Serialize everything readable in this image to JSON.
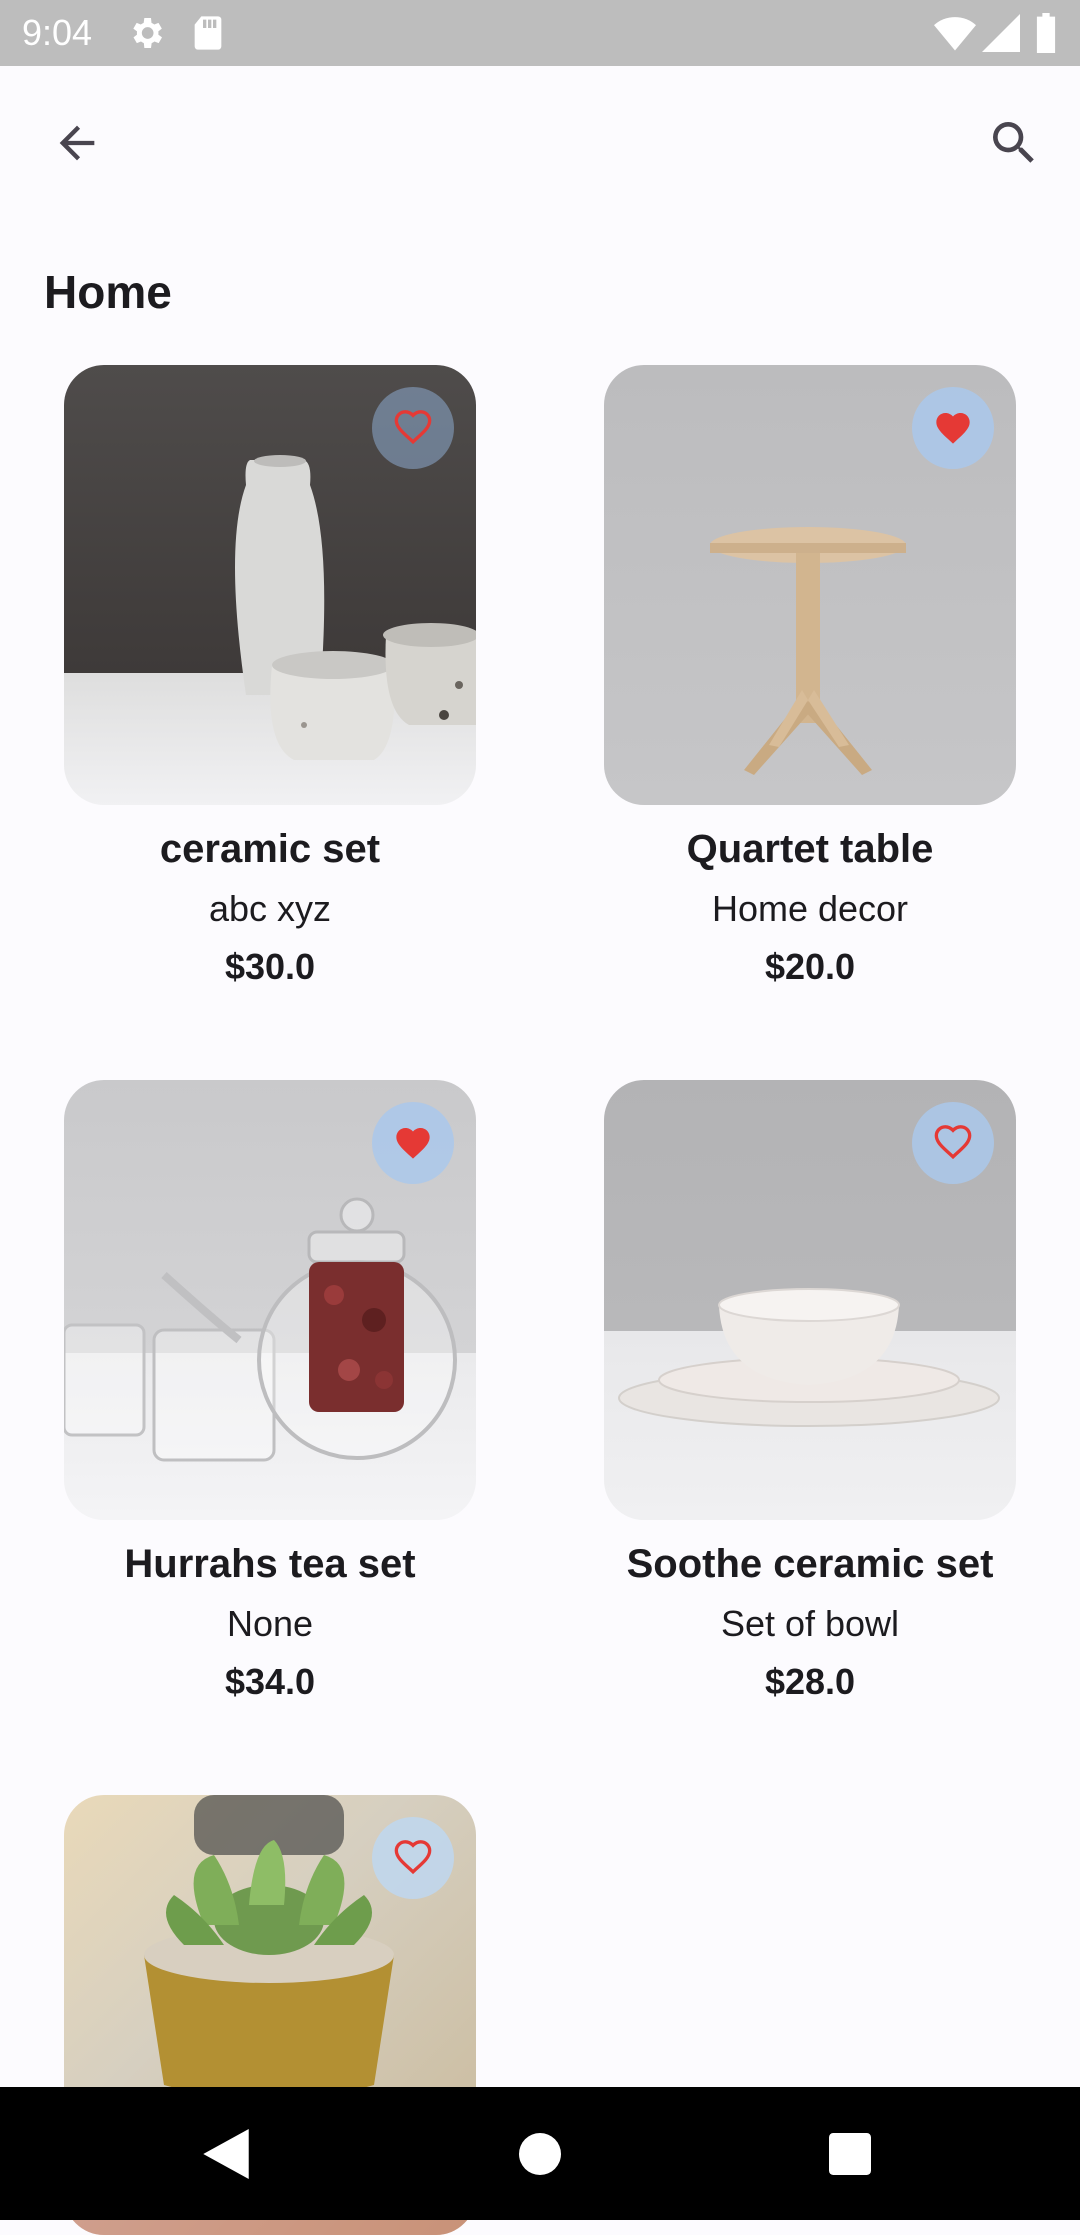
{
  "status_bar": {
    "time": "9:04",
    "icons": [
      "settings-icon",
      "sd-card-icon",
      "wifi-icon",
      "cellular-signal-icon",
      "battery-icon"
    ]
  },
  "app_bar": {
    "back_icon": "arrow-back-icon",
    "search_icon": "search-icon"
  },
  "page": {
    "title": "Home"
  },
  "products": [
    {
      "name": "ceramic set",
      "description": "abc xyz",
      "price": "$30.0",
      "favorite": false
    },
    {
      "name": "Quartet table",
      "description": "Home decor",
      "price": "$20.0",
      "favorite": true
    },
    {
      "name": "Hurrahs tea set",
      "description": "None",
      "price": "$34.0",
      "favorite": true
    },
    {
      "name": "Soothe ceramic set",
      "description": "Set of bowl",
      "price": "$28.0",
      "favorite": false
    },
    {
      "name": "",
      "description": "",
      "price": "",
      "favorite": false
    }
  ],
  "colors": {
    "accent_red": "#e53935",
    "fav_bg": "#b9cde6",
    "background": "#fcfbfe"
  },
  "nav_bar": {
    "icons": [
      "nav-back-icon",
      "nav-home-icon",
      "nav-recents-icon"
    ]
  }
}
